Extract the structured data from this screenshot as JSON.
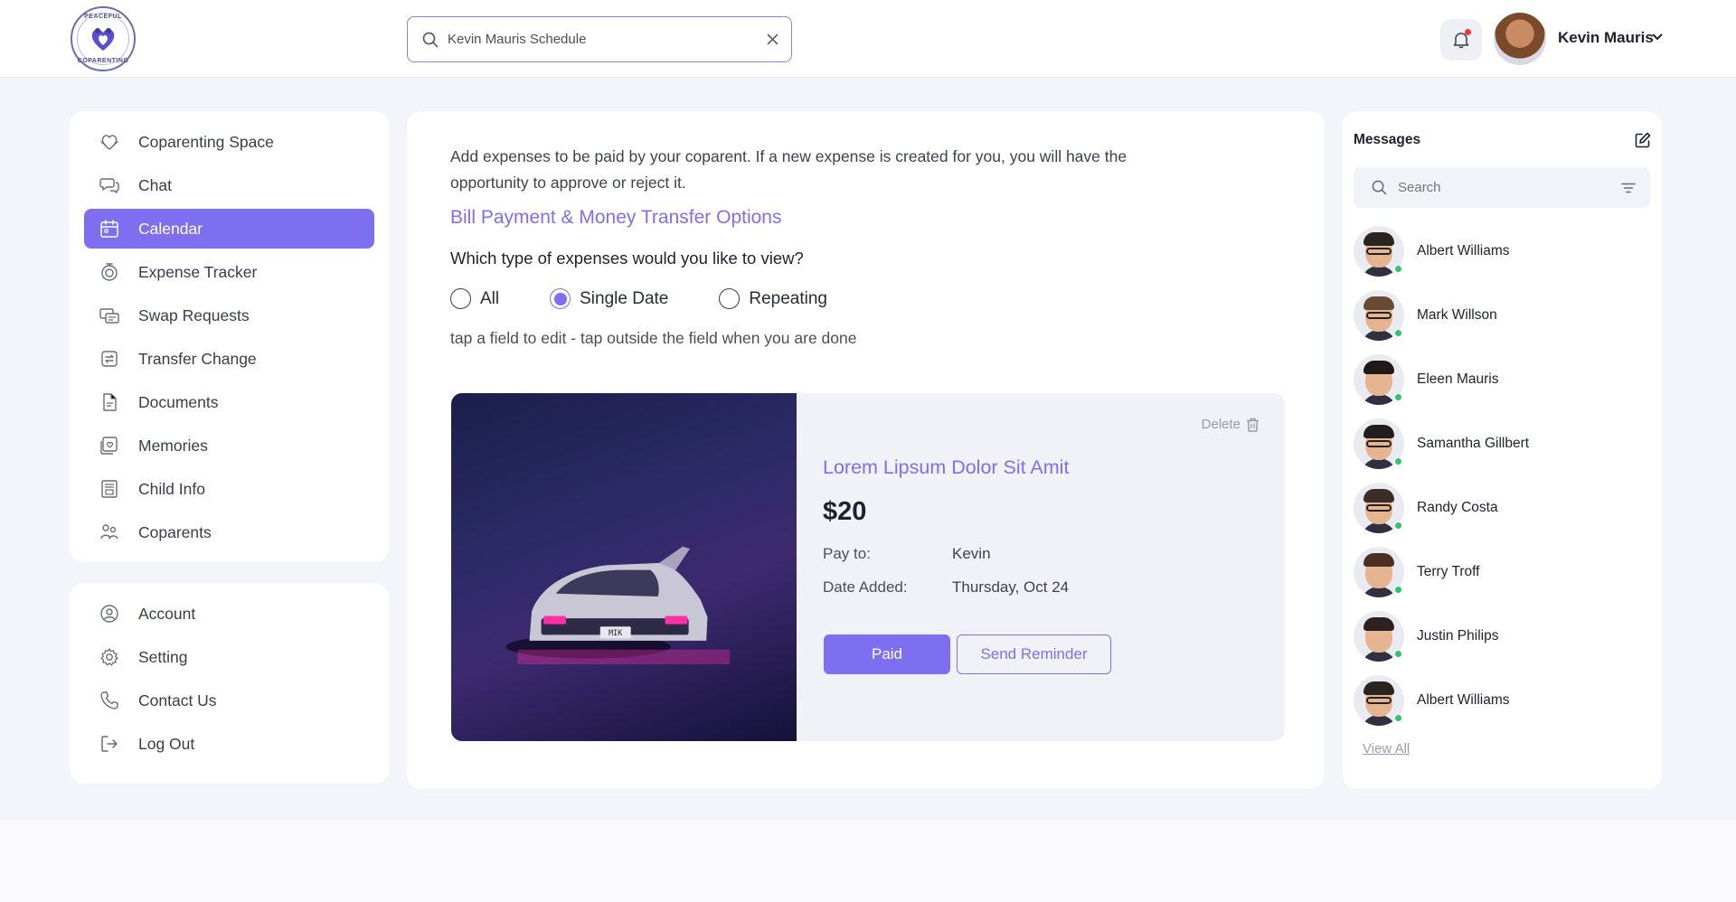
{
  "brand": {
    "logo_top": "PEACEFUL",
    "logo_bottom": "COPARENTING",
    "accent": "#7e6ff0"
  },
  "topbar": {
    "search_value": "Kevin Mauris Schedule",
    "user_name": "Kevin Mauris"
  },
  "nav": {
    "primary": [
      {
        "label": "Coparenting Space",
        "icon": "heart-hands-icon"
      },
      {
        "label": "Chat",
        "icon": "chat-icon"
      },
      {
        "label": "Calendar",
        "icon": "calendar-icon",
        "active": true
      },
      {
        "label": "Expense Tracker",
        "icon": "expense-icon"
      },
      {
        "label": "Swap Requests",
        "icon": "swap-icon"
      },
      {
        "label": "Transfer Change",
        "icon": "transfer-icon"
      },
      {
        "label": "Documents",
        "icon": "document-icon"
      },
      {
        "label": "Memories",
        "icon": "memories-icon"
      },
      {
        "label": "Child Info",
        "icon": "child-info-icon"
      },
      {
        "label": "Coparents",
        "icon": "coparents-icon"
      }
    ],
    "secondary": [
      {
        "label": "Account",
        "icon": "account-icon"
      },
      {
        "label": "Setting",
        "icon": "gear-icon"
      },
      {
        "label": "Contact Us",
        "icon": "phone-icon"
      },
      {
        "label": "Log Out",
        "icon": "logout-icon"
      }
    ]
  },
  "main": {
    "intro": "Add expenses to be paid by your coparent. If a new expense is created for you, you will have the opportunity to approve or reject it.",
    "link_title": "Bill Payment & Money Transfer Options",
    "question": "Which type of expenses would you like to view?",
    "options": [
      {
        "label": "All",
        "checked": false
      },
      {
        "label": "Single Date",
        "checked": true
      },
      {
        "label": "Repeating",
        "checked": false
      }
    ],
    "hint": "tap a field to edit - tap outside the field when you are done",
    "expense": {
      "delete_label": "Delete",
      "title": "Lorem Lipsum Dolor Sit Amit",
      "amount": "$20",
      "pay_to_label": "Pay to:",
      "pay_to_value": "Kevin",
      "date_label": "Date Added:",
      "date_value": "Thursday, Oct 24",
      "plate": "MIK",
      "paid_label": "Paid",
      "reminder_label": "Send Reminder"
    }
  },
  "messages": {
    "title": "Messages",
    "search_placeholder": "Search",
    "contacts": [
      {
        "name": "Albert Williams",
        "hair": "#2a2320",
        "glasses": true,
        "online": true
      },
      {
        "name": "Mark Willson",
        "hair": "#6b4a33",
        "glasses": true,
        "online": true
      },
      {
        "name": "Eleen Mauris",
        "hair": "#1f1a18",
        "glasses": false,
        "online": true
      },
      {
        "name": "Samantha Gillbert",
        "hair": "#231d1d",
        "glasses": true,
        "online": true
      },
      {
        "name": "Randy Costa",
        "hair": "#3a2e28",
        "glasses": true,
        "online": true
      },
      {
        "name": "Terry Troff",
        "hair": "#4b2f22",
        "glasses": false,
        "online": true
      },
      {
        "name": "Justin Philips",
        "hair": "#2d2220",
        "glasses": false,
        "online": true
      },
      {
        "name": "Albert Williams",
        "hair": "#2a2320",
        "glasses": true,
        "online": true
      }
    ],
    "view_all": "View All"
  }
}
